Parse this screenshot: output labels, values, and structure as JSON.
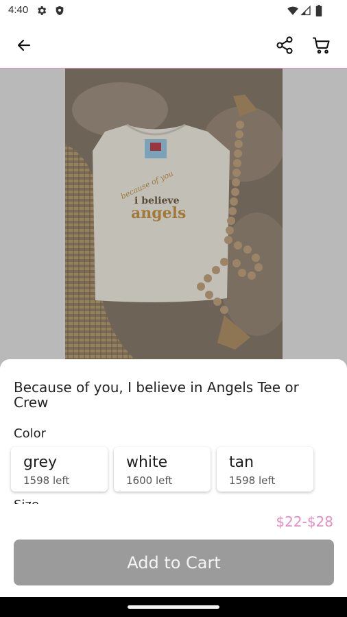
{
  "status_bar": {
    "time": "4:40",
    "icons": [
      "gear-icon",
      "shield-icon",
      "wifi-icon",
      "signal-icon",
      "battery-icon"
    ]
  },
  "app_bar": {
    "back_icon": "back-arrow-icon",
    "share_icon": "share-icon",
    "cart_icon": "cart-icon",
    "accent_color": "#e58fc0"
  },
  "product": {
    "image_alt_text_printed": [
      "because of you",
      "i believe",
      "angels"
    ],
    "title": "Because of you, I believe in Angels Tee or Crew",
    "color_label": "Color",
    "colors": [
      {
        "name": "grey",
        "stock": "1598 left"
      },
      {
        "name": "white",
        "stock": "1600 left"
      },
      {
        "name": "tan",
        "stock": "1598 left"
      }
    ],
    "size_label": "Size",
    "price": "$22-$28",
    "price_color": "#e88dc1",
    "add_to_cart": "Add to Cart"
  }
}
